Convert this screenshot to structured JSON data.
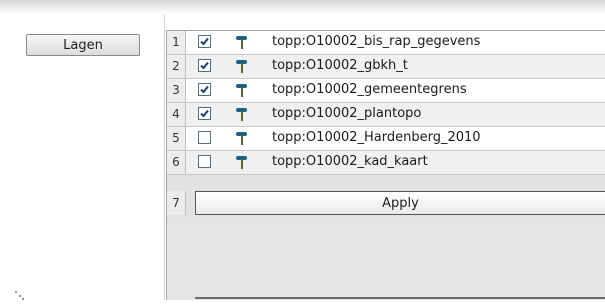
{
  "sidebar": {
    "lagen_label": "Lagen"
  },
  "layers": [
    {
      "num": "1",
      "checked": true,
      "name": "topp:O10002_bis_rap_gegevens"
    },
    {
      "num": "2",
      "checked": true,
      "name": "topp:O10002_gbkh_t"
    },
    {
      "num": "3",
      "checked": true,
      "name": "topp:O10002_gemeentegrens"
    },
    {
      "num": "4",
      "checked": true,
      "name": "topp:O10002_plantopo"
    },
    {
      "num": "5",
      "checked": false,
      "name": "topp:O10002_Hardenberg_2010"
    },
    {
      "num": "6",
      "checked": false,
      "name": "topp:O10002_kad_kaart"
    }
  ],
  "apply": {
    "num": "7",
    "label": "Apply"
  },
  "colors": {
    "checkmark": "#1f3d6b",
    "icon_head": "#1e5f86",
    "icon_stem": "#4f6a2b"
  },
  "icons": {
    "layer": "layer-flag-icon"
  }
}
